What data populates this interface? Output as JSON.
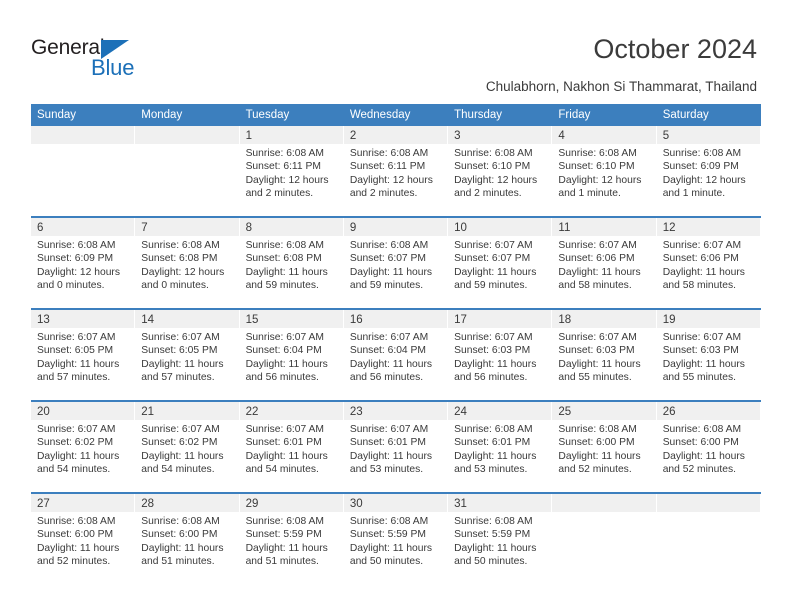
{
  "brand": {
    "name_top": "General",
    "name_bottom": "Blue",
    "accent_color": "#1c70b8"
  },
  "header": {
    "title": "October 2024",
    "subtitle": "Chulabhorn, Nakhon Si Thammarat, Thailand"
  },
  "theme": {
    "header_bar_color": "#3c7fbe",
    "daynum_band_color": "#f0f0f0",
    "text_color": "#3a3a3a",
    "separator_color": "#3c7fbe"
  },
  "weekdays": [
    "Sunday",
    "Monday",
    "Tuesday",
    "Wednesday",
    "Thursday",
    "Friday",
    "Saturday"
  ],
  "weeks": [
    [
      {
        "day": "",
        "lines": []
      },
      {
        "day": "",
        "lines": []
      },
      {
        "day": "1",
        "lines": [
          "Sunrise: 6:08 AM",
          "Sunset: 6:11 PM",
          "Daylight: 12 hours and 2 minutes."
        ]
      },
      {
        "day": "2",
        "lines": [
          "Sunrise: 6:08 AM",
          "Sunset: 6:11 PM",
          "Daylight: 12 hours and 2 minutes."
        ]
      },
      {
        "day": "3",
        "lines": [
          "Sunrise: 6:08 AM",
          "Sunset: 6:10 PM",
          "Daylight: 12 hours and 2 minutes."
        ]
      },
      {
        "day": "4",
        "lines": [
          "Sunrise: 6:08 AM",
          "Sunset: 6:10 PM",
          "Daylight: 12 hours and 1 minute."
        ]
      },
      {
        "day": "5",
        "lines": [
          "Sunrise: 6:08 AM",
          "Sunset: 6:09 PM",
          "Daylight: 12 hours and 1 minute."
        ]
      }
    ],
    [
      {
        "day": "6",
        "lines": [
          "Sunrise: 6:08 AM",
          "Sunset: 6:09 PM",
          "Daylight: 12 hours and 0 minutes."
        ]
      },
      {
        "day": "7",
        "lines": [
          "Sunrise: 6:08 AM",
          "Sunset: 6:08 PM",
          "Daylight: 12 hours and 0 minutes."
        ]
      },
      {
        "day": "8",
        "lines": [
          "Sunrise: 6:08 AM",
          "Sunset: 6:08 PM",
          "Daylight: 11 hours and 59 minutes."
        ]
      },
      {
        "day": "9",
        "lines": [
          "Sunrise: 6:08 AM",
          "Sunset: 6:07 PM",
          "Daylight: 11 hours and 59 minutes."
        ]
      },
      {
        "day": "10",
        "lines": [
          "Sunrise: 6:07 AM",
          "Sunset: 6:07 PM",
          "Daylight: 11 hours and 59 minutes."
        ]
      },
      {
        "day": "11",
        "lines": [
          "Sunrise: 6:07 AM",
          "Sunset: 6:06 PM",
          "Daylight: 11 hours and 58 minutes."
        ]
      },
      {
        "day": "12",
        "lines": [
          "Sunrise: 6:07 AM",
          "Sunset: 6:06 PM",
          "Daylight: 11 hours and 58 minutes."
        ]
      }
    ],
    [
      {
        "day": "13",
        "lines": [
          "Sunrise: 6:07 AM",
          "Sunset: 6:05 PM",
          "Daylight: 11 hours and 57 minutes."
        ]
      },
      {
        "day": "14",
        "lines": [
          "Sunrise: 6:07 AM",
          "Sunset: 6:05 PM",
          "Daylight: 11 hours and 57 minutes."
        ]
      },
      {
        "day": "15",
        "lines": [
          "Sunrise: 6:07 AM",
          "Sunset: 6:04 PM",
          "Daylight: 11 hours and 56 minutes."
        ]
      },
      {
        "day": "16",
        "lines": [
          "Sunrise: 6:07 AM",
          "Sunset: 6:04 PM",
          "Daylight: 11 hours and 56 minutes."
        ]
      },
      {
        "day": "17",
        "lines": [
          "Sunrise: 6:07 AM",
          "Sunset: 6:03 PM",
          "Daylight: 11 hours and 56 minutes."
        ]
      },
      {
        "day": "18",
        "lines": [
          "Sunrise: 6:07 AM",
          "Sunset: 6:03 PM",
          "Daylight: 11 hours and 55 minutes."
        ]
      },
      {
        "day": "19",
        "lines": [
          "Sunrise: 6:07 AM",
          "Sunset: 6:03 PM",
          "Daylight: 11 hours and 55 minutes."
        ]
      }
    ],
    [
      {
        "day": "20",
        "lines": [
          "Sunrise: 6:07 AM",
          "Sunset: 6:02 PM",
          "Daylight: 11 hours and 54 minutes."
        ]
      },
      {
        "day": "21",
        "lines": [
          "Sunrise: 6:07 AM",
          "Sunset: 6:02 PM",
          "Daylight: 11 hours and 54 minutes."
        ]
      },
      {
        "day": "22",
        "lines": [
          "Sunrise: 6:07 AM",
          "Sunset: 6:01 PM",
          "Daylight: 11 hours and 54 minutes."
        ]
      },
      {
        "day": "23",
        "lines": [
          "Sunrise: 6:07 AM",
          "Sunset: 6:01 PM",
          "Daylight: 11 hours and 53 minutes."
        ]
      },
      {
        "day": "24",
        "lines": [
          "Sunrise: 6:08 AM",
          "Sunset: 6:01 PM",
          "Daylight: 11 hours and 53 minutes."
        ]
      },
      {
        "day": "25",
        "lines": [
          "Sunrise: 6:08 AM",
          "Sunset: 6:00 PM",
          "Daylight: 11 hours and 52 minutes."
        ]
      },
      {
        "day": "26",
        "lines": [
          "Sunrise: 6:08 AM",
          "Sunset: 6:00 PM",
          "Daylight: 11 hours and 52 minutes."
        ]
      }
    ],
    [
      {
        "day": "27",
        "lines": [
          "Sunrise: 6:08 AM",
          "Sunset: 6:00 PM",
          "Daylight: 11 hours and 52 minutes."
        ]
      },
      {
        "day": "28",
        "lines": [
          "Sunrise: 6:08 AM",
          "Sunset: 6:00 PM",
          "Daylight: 11 hours and 51 minutes."
        ]
      },
      {
        "day": "29",
        "lines": [
          "Sunrise: 6:08 AM",
          "Sunset: 5:59 PM",
          "Daylight: 11 hours and 51 minutes."
        ]
      },
      {
        "day": "30",
        "lines": [
          "Sunrise: 6:08 AM",
          "Sunset: 5:59 PM",
          "Daylight: 11 hours and 50 minutes."
        ]
      },
      {
        "day": "31",
        "lines": [
          "Sunrise: 6:08 AM",
          "Sunset: 5:59 PM",
          "Daylight: 11 hours and 50 minutes."
        ]
      },
      {
        "day": "",
        "lines": []
      },
      {
        "day": "",
        "lines": []
      }
    ]
  ]
}
